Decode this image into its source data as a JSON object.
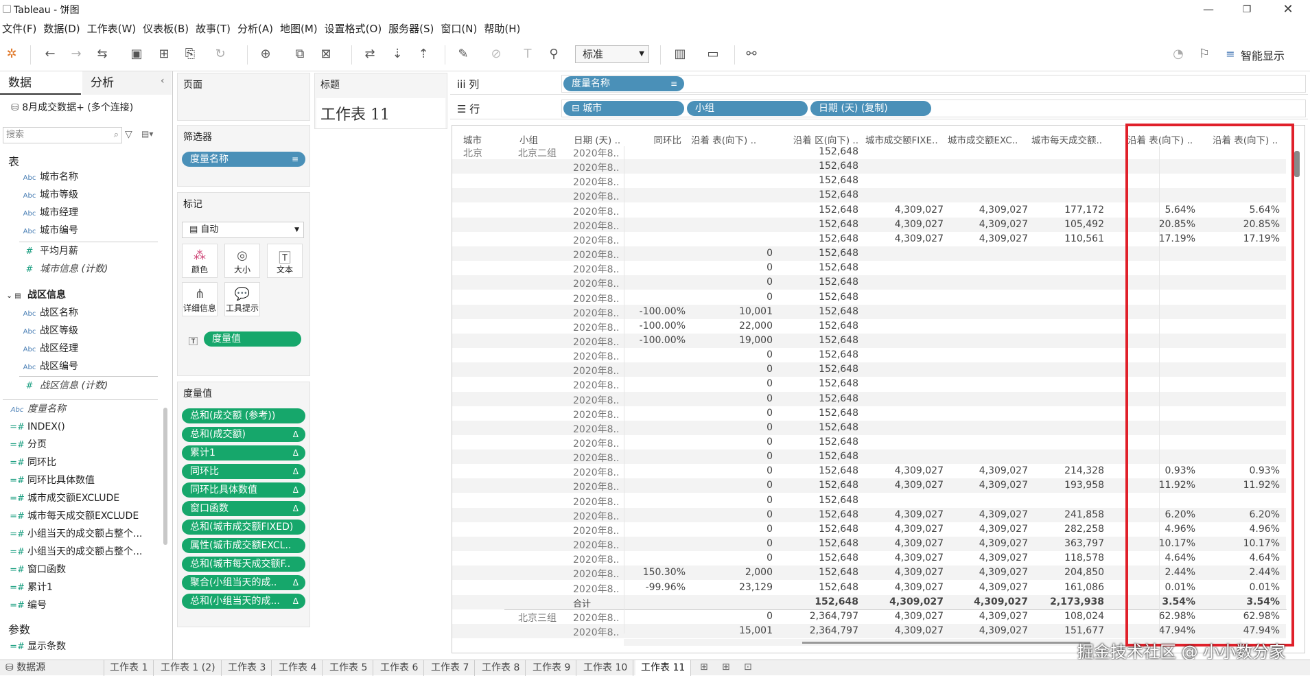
{
  "window": {
    "title": "Tableau - 饼图"
  },
  "menu": [
    "文件(F)",
    "数据(D)",
    "工作表(W)",
    "仪表板(B)",
    "故事(T)",
    "分析(A)",
    "地图(M)",
    "设置格式(O)",
    "服务器(S)",
    "窗口(N)",
    "帮助(H)"
  ],
  "toolbar": {
    "fit_select": "标准",
    "smart_show": "智能显示"
  },
  "leftpane": {
    "tab_data": "数据",
    "tab_analysis": "分析",
    "datasource": "8月成交数据+ (多个连接)",
    "search_placeholder": "搜索",
    "tables_header": "表",
    "fields_a": [
      "城市名称",
      "城市等级",
      "城市经理",
      "城市编号"
    ],
    "measure_a1": "平均月薪",
    "measure_a2": "城市信息 (计数)",
    "group_b": "战区信息",
    "fields_b": [
      "战区名称",
      "战区等级",
      "战区经理",
      "战区编号"
    ],
    "measure_b": "战区信息 (计数)",
    "measure_names": "度量名称",
    "calc_fields": [
      "INDEX()",
      "分页",
      "同环比",
      "同环比具体数值",
      "城市成交额EXCLUDE",
      "城市每天成交额EXCLUDE",
      "小组当天的成交额占整个...",
      "小组当天的成交额占整个...",
      "窗口函数",
      "累计1",
      "编号"
    ],
    "params_header": "参数",
    "params": [
      "显示条数"
    ]
  },
  "shelves": {
    "pages": "页面",
    "filters": "筛选器",
    "filter_pill": "度量名称",
    "marks": "标记",
    "marks_type": "自动",
    "mark_buttons": [
      "颜色",
      "大小",
      "文本",
      "详细信息",
      "工具提示"
    ],
    "mark_pill": "度量值",
    "measure_values": "度量值",
    "mv_pills": [
      "总和(成交额 (参考))",
      "总和(成交额)",
      "累计1",
      "同环比",
      "同环比具体数值",
      "窗口函数",
      "总和(城市成交额FIXED)",
      "属性(城市成交额EXCL..",
      "总和(城市每天成交额F..",
      "聚合(小组当天的成..",
      "总和(小组当天的成..."
    ],
    "title_header": "标题",
    "title_text": "工作表 11",
    "columns_label": "iii 列",
    "rows_label": "☰ 行",
    "col_pill": "度量名称",
    "row_pills": [
      "⊟ 城市",
      "小组",
      "日期 (天) (复制)"
    ]
  },
  "table": {
    "headers": [
      "城市",
      "小组",
      "日期 (天) ..",
      "同环比",
      "沿着 表(向下) ..",
      "沿着 区(向下) ..",
      "城市成交额FIXE..",
      "城市成交额EXC..",
      "城市每天成交额..",
      "沿着 表(向下) ..",
      "沿着 表(向下) .."
    ],
    "city": "北京",
    "group1": "北京二组",
    "group2": "北京三组",
    "total_label": "合计",
    "rows": [
      [
        "2020年8..",
        "",
        "",
        "152,648",
        "",
        "",
        "",
        "",
        ""
      ],
      [
        "2020年8..",
        "",
        "",
        "152,648",
        "",
        "",
        "",
        "",
        ""
      ],
      [
        "2020年8..",
        "",
        "",
        "152,648",
        "",
        "",
        "",
        "",
        ""
      ],
      [
        "2020年8..",
        "",
        "",
        "152,648",
        "",
        "",
        "",
        "",
        ""
      ],
      [
        "2020年8..",
        "",
        "",
        "152,648",
        "4,309,027",
        "4,309,027",
        "177,172",
        "5.64%",
        "5.64%"
      ],
      [
        "2020年8..",
        "",
        "",
        "152,648",
        "4,309,027",
        "4,309,027",
        "105,492",
        "20.85%",
        "20.85%"
      ],
      [
        "2020年8..",
        "",
        "",
        "152,648",
        "4,309,027",
        "4,309,027",
        "110,561",
        "17.19%",
        "17.19%"
      ],
      [
        "2020年8..",
        "",
        "0",
        "152,648",
        "",
        "",
        "",
        "",
        ""
      ],
      [
        "2020年8..",
        "",
        "0",
        "152,648",
        "",
        "",
        "",
        "",
        ""
      ],
      [
        "2020年8..",
        "",
        "0",
        "152,648",
        "",
        "",
        "",
        "",
        ""
      ],
      [
        "2020年8..",
        "",
        "0",
        "152,648",
        "",
        "",
        "",
        "",
        ""
      ],
      [
        "2020年8..",
        "-100.00%",
        "10,001",
        "152,648",
        "",
        "",
        "",
        "",
        ""
      ],
      [
        "2020年8..",
        "-100.00%",
        "22,000",
        "152,648",
        "",
        "",
        "",
        "",
        ""
      ],
      [
        "2020年8..",
        "-100.00%",
        "19,000",
        "152,648",
        "",
        "",
        "",
        "",
        ""
      ],
      [
        "2020年8..",
        "",
        "0",
        "152,648",
        "",
        "",
        "",
        "",
        ""
      ],
      [
        "2020年8..",
        "",
        "0",
        "152,648",
        "",
        "",
        "",
        "",
        ""
      ],
      [
        "2020年8..",
        "",
        "0",
        "152,648",
        "",
        "",
        "",
        "",
        ""
      ],
      [
        "2020年8..",
        "",
        "0",
        "152,648",
        "",
        "",
        "",
        "",
        ""
      ],
      [
        "2020年8..",
        "",
        "0",
        "152,648",
        "",
        "",
        "",
        "",
        ""
      ],
      [
        "2020年8..",
        "",
        "0",
        "152,648",
        "",
        "",
        "",
        "",
        ""
      ],
      [
        "2020年8..",
        "",
        "0",
        "152,648",
        "",
        "",
        "",
        "",
        ""
      ],
      [
        "2020年8..",
        "",
        "0",
        "152,648",
        "",
        "",
        "",
        "",
        ""
      ],
      [
        "2020年8..",
        "",
        "0",
        "152,648",
        "4,309,027",
        "4,309,027",
        "214,328",
        "0.93%",
        "0.93%"
      ],
      [
        "2020年8..",
        "",
        "0",
        "152,648",
        "4,309,027",
        "4,309,027",
        "193,958",
        "11.92%",
        "11.92%"
      ],
      [
        "2020年8..",
        "",
        "0",
        "152,648",
        "",
        "",
        "",
        "",
        ""
      ],
      [
        "2020年8..",
        "",
        "0",
        "152,648",
        "4,309,027",
        "4,309,027",
        "241,858",
        "6.20%",
        "6.20%"
      ],
      [
        "2020年8..",
        "",
        "0",
        "152,648",
        "4,309,027",
        "4,309,027",
        "282,258",
        "4.96%",
        "4.96%"
      ],
      [
        "2020年8..",
        "",
        "0",
        "152,648",
        "4,309,027",
        "4,309,027",
        "363,797",
        "10.17%",
        "10.17%"
      ],
      [
        "2020年8..",
        "",
        "0",
        "152,648",
        "4,309,027",
        "4,309,027",
        "118,578",
        "4.64%",
        "4.64%"
      ],
      [
        "2020年8..",
        "150.30%",
        "2,000",
        "152,648",
        "4,309,027",
        "4,309,027",
        "204,850",
        "2.44%",
        "2.44%"
      ],
      [
        "2020年8..",
        "-99.96%",
        "23,129",
        "152,648",
        "4,309,027",
        "4,309,027",
        "161,086",
        "0.01%",
        "0.01%"
      ]
    ],
    "total": [
      "",
      "",
      "152,648",
      "4,309,027",
      "4,309,027",
      "2,173,938",
      "3.54%",
      "3.54%"
    ],
    "after": [
      [
        "2020年8..",
        "",
        "0",
        "2,364,797",
        "4,309,027",
        "4,309,027",
        "108,024",
        "62.98%",
        "62.98%"
      ],
      [
        "2020年8..",
        "",
        "15,001",
        "2,364,797",
        "4,309,027",
        "4,309,027",
        "151,677",
        "47.94%",
        "47.94%"
      ]
    ]
  },
  "tabs": [
    "数据源",
    "工作表 1",
    "工作表 1 (2)",
    "工作表 3",
    "工作表 4",
    "工作表 5",
    "工作表 6",
    "工作表 7",
    "工作表 8",
    "工作表 9",
    "工作表 10",
    "工作表 11"
  ],
  "watermark": "掘金技术社区 @ 小小数分家"
}
